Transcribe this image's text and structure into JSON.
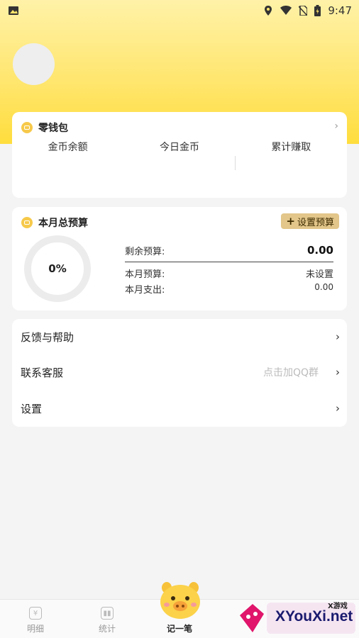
{
  "status_bar": {
    "time": "9:47",
    "icons": [
      "image-icon",
      "location-icon",
      "wifi-icon",
      "no-sim-icon",
      "battery-icon"
    ]
  },
  "wallet": {
    "title": "零钱包",
    "columns": [
      "金币余额",
      "今日金币",
      "累计赚取"
    ]
  },
  "budget": {
    "title": "本月总预算",
    "set_button": "设置预算",
    "percent": "0%",
    "remaining_label": "剩余预算:",
    "remaining_value": "0.00",
    "month_budget_label": "本月预算:",
    "month_budget_value": "未设置",
    "month_spend_label": "本月支出:",
    "month_spend_value": "0.00"
  },
  "menu": {
    "items": [
      {
        "label": "反馈与帮助",
        "hint": ""
      },
      {
        "label": "联系客服",
        "hint": "点击加QQ群"
      },
      {
        "label": "设置",
        "hint": ""
      }
    ]
  },
  "tabbar": {
    "tabs": [
      {
        "label": "明细",
        "icon": "yen-icon"
      },
      {
        "label": "统计",
        "icon": "chart-icon"
      },
      {
        "label": "记一笔",
        "icon": "pig-icon"
      }
    ]
  },
  "watermark": {
    "text": "XYouXi.net",
    "small": "X游戏"
  },
  "colors": {
    "header_yellow": "#ffdd3d",
    "coin": "#f6c94a",
    "set_budget_bg": "#e2c68a"
  }
}
